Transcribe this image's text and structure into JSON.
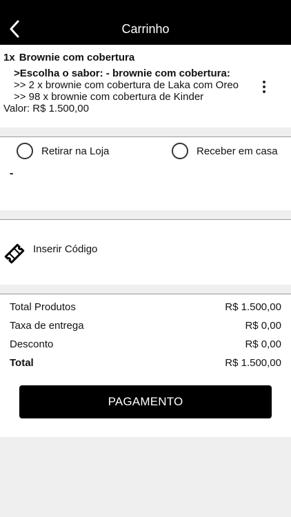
{
  "header": {
    "title": "Carrinho",
    "back_icon": "chevron-left-icon"
  },
  "cart": {
    "item": {
      "quantity": "1x",
      "name": "Brownie com cobertura",
      "option_title": ">Escolha o sabor: - brownie com cobertura:",
      "option_lines": [
        ">> 2 x brownie com cobertura de Laka com Oreo",
        ">> 98 x brownie com cobertura de Kinder"
      ],
      "value": "Valor: R$ 1.500,00",
      "more_icon": "more-vertical-icon"
    }
  },
  "delivery": {
    "options": [
      {
        "label": "Retirar na Loja",
        "selected": false
      },
      {
        "label": "Receber em casa",
        "selected": false
      }
    ],
    "address": "-"
  },
  "coupon": {
    "label": "Inserir Código",
    "icon": "ticket-icon"
  },
  "summary": {
    "rows": [
      {
        "label": "Total Produtos",
        "value": "R$ 1.500,00"
      },
      {
        "label": "Taxa de entrega",
        "value": "R$ 0,00"
      },
      {
        "label": "Desconto",
        "value": "R$ 0,00"
      },
      {
        "label": "Total",
        "value": "R$ 1.500,00"
      }
    ],
    "pay_button": "PAGAMENTO"
  },
  "colors": {
    "header_bg": "#000000",
    "page_bg": "#efefef",
    "button_bg": "#000000"
  }
}
